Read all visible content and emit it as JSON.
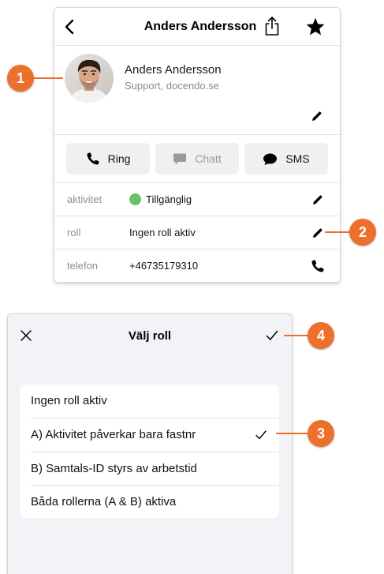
{
  "contact": {
    "header_title": "Anders Andersson",
    "name": "Anders Andersson",
    "subtitle": "Support, docendo.se",
    "actions": [
      {
        "label": "Ring",
        "icon": "phone-icon",
        "enabled": true
      },
      {
        "label": "Chatt",
        "icon": "chat-bubble-icon",
        "enabled": false
      },
      {
        "label": "SMS",
        "icon": "speech-bubble-icon",
        "enabled": true
      }
    ],
    "rows": [
      {
        "label": "aktivitet",
        "value": "Tillgänglig",
        "status_color": "#68c162",
        "action_icon": "pencil-icon"
      },
      {
        "label": "roll",
        "value": "Ingen roll aktiv",
        "action_icon": "pencil-icon"
      },
      {
        "label": "telefon",
        "value": "+46735179310",
        "action_icon": "phone-icon"
      }
    ]
  },
  "role_picker": {
    "title": "Välj roll",
    "close_icon": "close-icon",
    "confirm_icon": "checkmark-icon",
    "options": [
      {
        "label": "Ingen roll aktiv",
        "selected": false
      },
      {
        "label": "A) Aktivitet påverkar bara fastnr",
        "selected": true
      },
      {
        "label": "B) Samtals-ID styrs av arbetstid",
        "selected": false
      },
      {
        "label": "Båda rollerna (A & B) aktiva",
        "selected": false
      }
    ]
  },
  "callouts": [
    "1",
    "2",
    "3",
    "4"
  ],
  "colors": {
    "callout": "#ed6f2c",
    "status_available": "#68c162",
    "picker_background": "#f2f2f7"
  }
}
